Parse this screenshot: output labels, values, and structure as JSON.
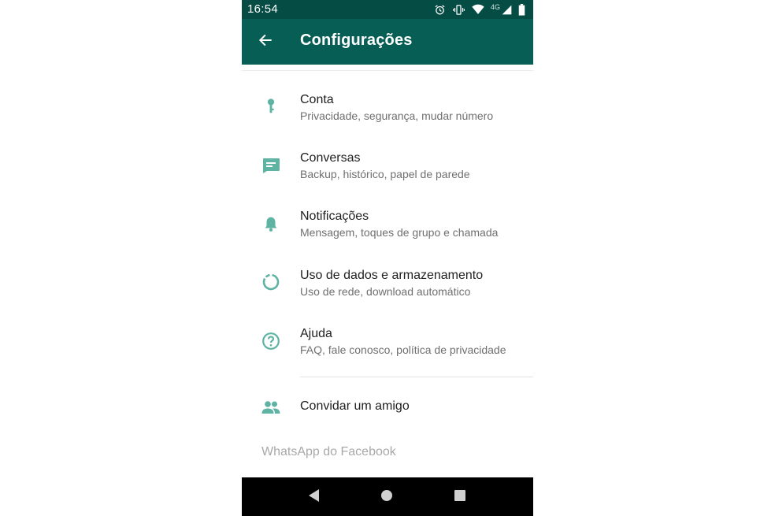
{
  "status_bar": {
    "time": "16:54",
    "network_label": "4G",
    "icons": [
      "alarm-icon",
      "vibrate-icon",
      "wifi-icon",
      "signal-icon",
      "battery-icon"
    ]
  },
  "app_bar": {
    "title": "Configurações",
    "back_icon": "arrow-back-icon",
    "background": "#075e54",
    "status_background": "#054d44"
  },
  "settings": {
    "accent_color": "#5fb3a3",
    "items": [
      {
        "icon": "key-icon",
        "title": "Conta",
        "subtitle": "Privacidade, segurança, mudar número"
      },
      {
        "icon": "chat-icon",
        "title": "Conversas",
        "subtitle": "Backup, histórico, papel de parede"
      },
      {
        "icon": "bell-icon",
        "title": "Notificações",
        "subtitle": "Mensagem, toques de grupo e chamada"
      },
      {
        "icon": "data-usage-icon",
        "title": "Uso de dados e armazenamento",
        "subtitle": "Uso de rede, download automático"
      },
      {
        "icon": "help-icon",
        "title": "Ajuda",
        "subtitle": "FAQ, fale conosco, política de privacidade"
      }
    ],
    "invite": {
      "icon": "people-icon",
      "title": "Convidar um amigo"
    }
  },
  "footer": {
    "text": "WhatsApp do Facebook"
  },
  "nav_bar": {
    "buttons": [
      "nav-back-icon",
      "nav-home-icon",
      "nav-recents-icon"
    ]
  }
}
